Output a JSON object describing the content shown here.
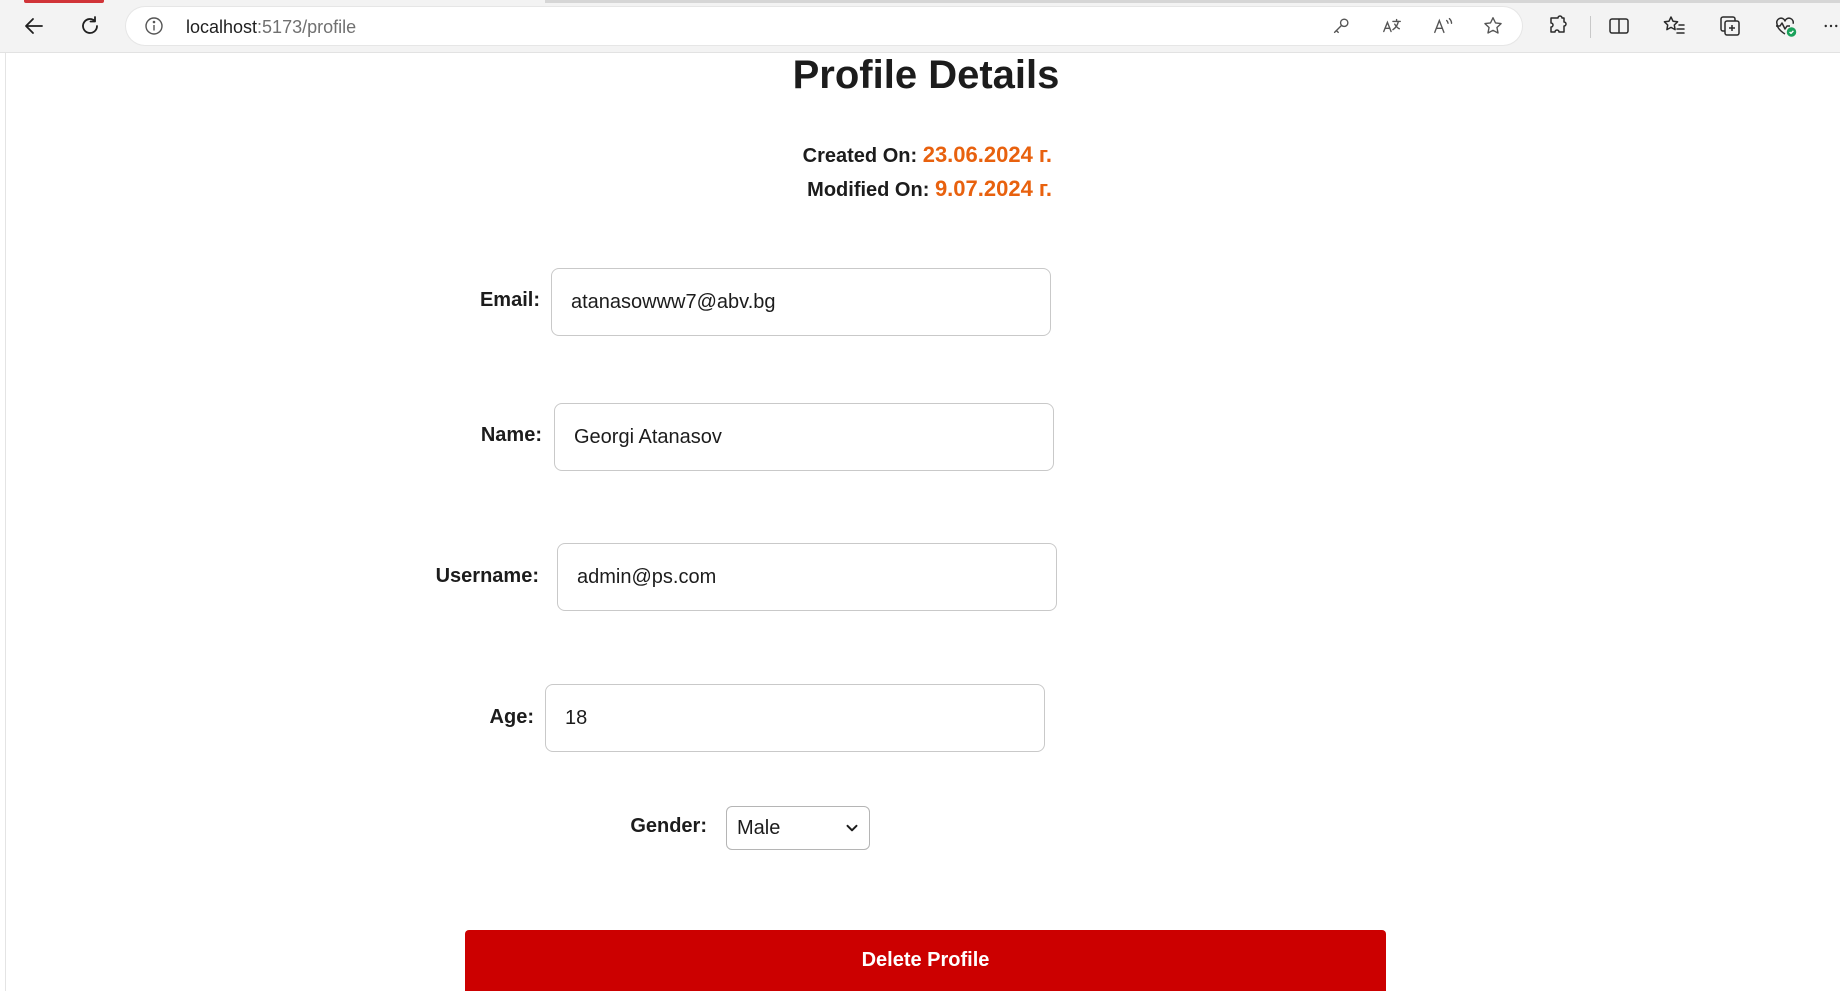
{
  "browser": {
    "url_host": "localhost",
    "url_rest": ":5173/profile",
    "icons": {
      "back": "back-arrow-icon",
      "refresh": "refresh-icon",
      "info": "info-icon",
      "password": "key-icon",
      "translate": "translate-icon",
      "read_aloud": "read-aloud-icon",
      "favorite": "star-icon",
      "extensions": "puzzle-icon",
      "split": "split-screen-icon",
      "favorites": "favorites-list-icon",
      "collections": "collections-icon",
      "health": "browser-essentials-icon",
      "more": "more-icon"
    }
  },
  "profile": {
    "title": "Profile Details",
    "created_label": "Created On:",
    "created_value": "23.06.2024 г.",
    "modified_label": "Modified On:",
    "modified_value": "9.07.2024 г.",
    "email_label": "Email:",
    "email_value": "atanasowww7@abv.bg",
    "name_label": "Name:",
    "name_value": "Georgi Atanasov",
    "username_label": "Username:",
    "username_value": "admin@ps.com",
    "age_label": "Age:",
    "age_value": "18",
    "gender_label": "Gender:",
    "gender_value": "Male",
    "delete_label": "Delete Profile"
  },
  "colors": {
    "accent_orange": "#e8610e",
    "delete_red": "#cc0000"
  }
}
